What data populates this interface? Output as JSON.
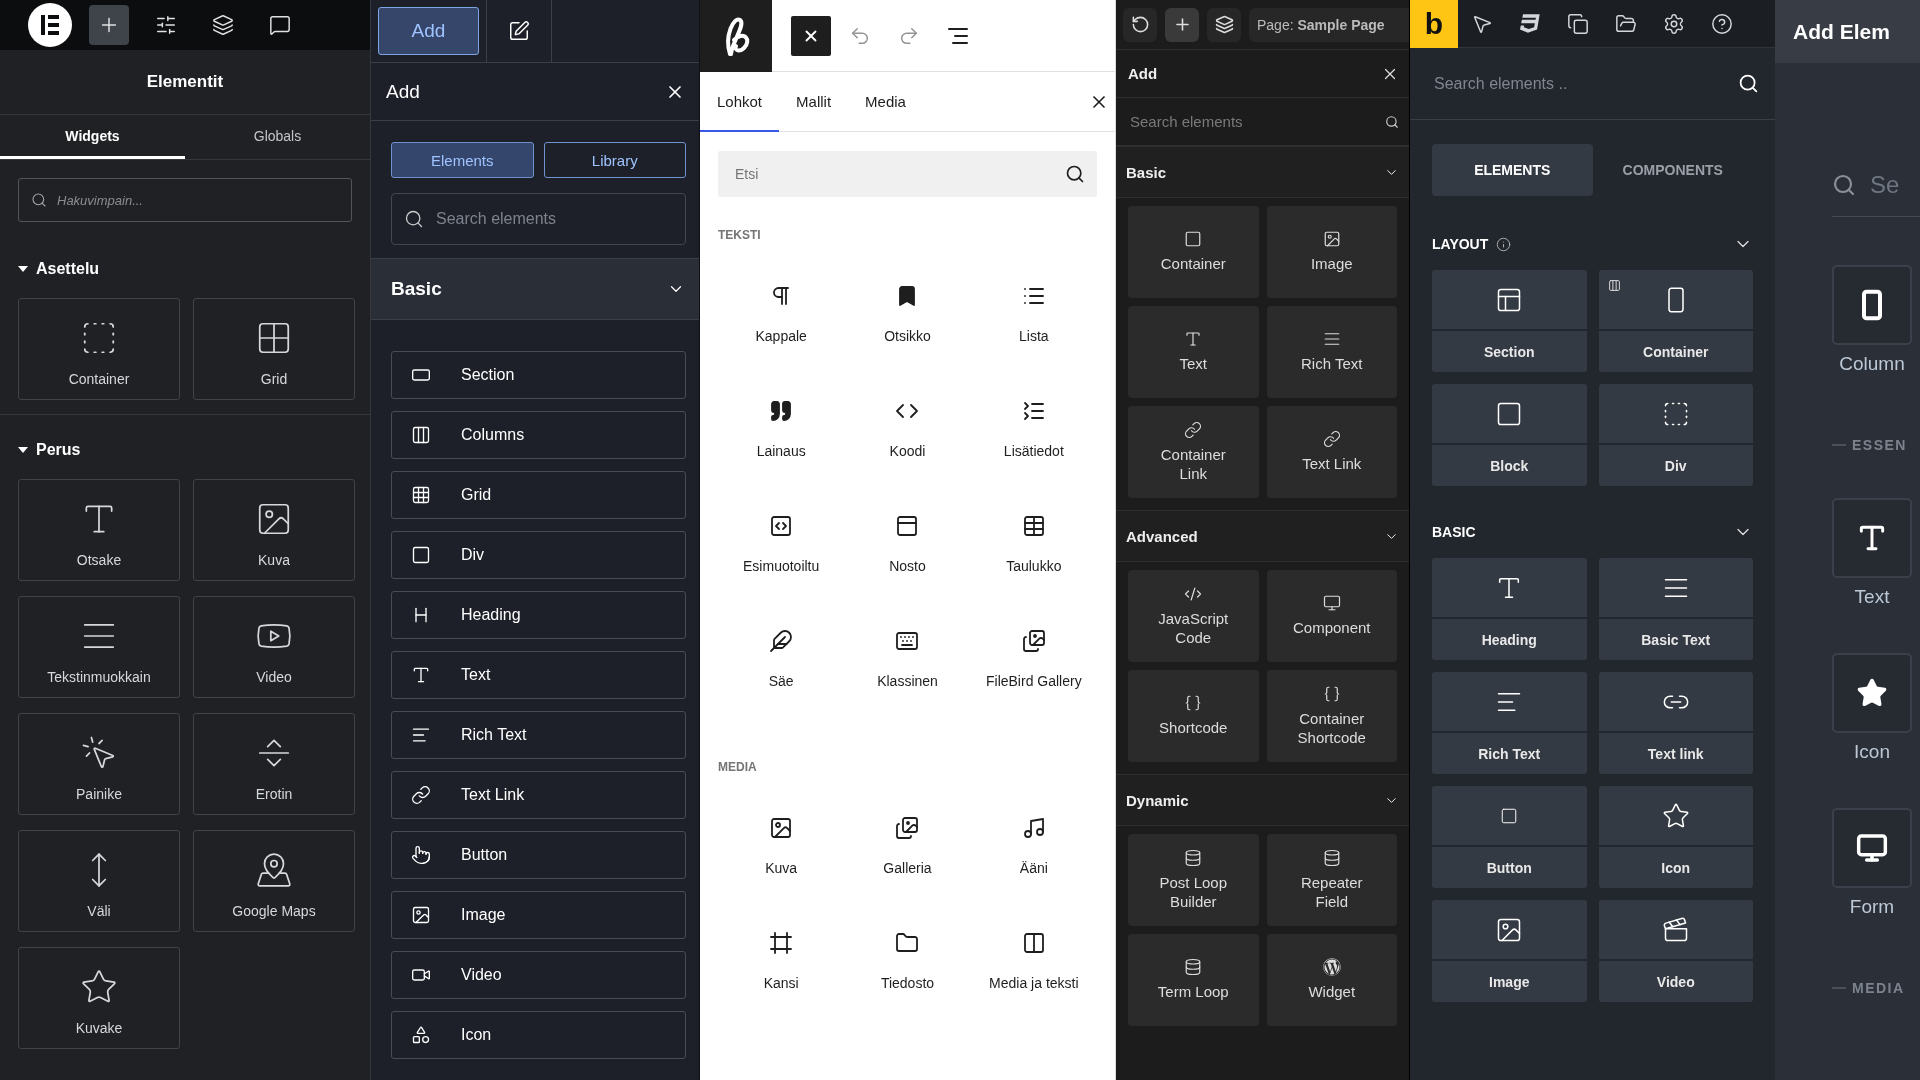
{
  "elementor": {
    "toolbar": [
      {
        "selected": true
      },
      {
        "selected": false
      },
      {
        "selected": false
      },
      {
        "selected": false
      }
    ],
    "title": "Elementit",
    "tabs": [
      {
        "label": "Widgets",
        "selected": true
      },
      {
        "label": "Globals",
        "selected": false
      }
    ],
    "search": {
      "placeholder": "Hakuvimpain..."
    },
    "sections": [
      {
        "title": "Asettelu",
        "expanded": true,
        "widgets": [
          "Container",
          "Grid"
        ]
      },
      {
        "title": "Perus",
        "expanded": true,
        "widgets": [
          "Otsake",
          "Kuva",
          "Tekstinmuokkain",
          "Video",
          "Painike",
          "Erotin",
          "Väli",
          "Google Maps",
          "Kuvake"
        ]
      }
    ]
  },
  "add_panel": {
    "top_button": {
      "label": "Add",
      "selected": true
    },
    "title": "Add",
    "tabs": [
      {
        "label": "Elements",
        "selected": true
      },
      {
        "label": "Library",
        "selected": false
      }
    ],
    "search": {
      "placeholder": "Search elements"
    },
    "section": {
      "title": "Basic",
      "expanded": true
    },
    "items": [
      "Section",
      "Columns",
      "Grid",
      "Div",
      "Heading",
      "Text",
      "Rich Text",
      "Text Link",
      "Button",
      "Image",
      "Video",
      "Icon"
    ]
  },
  "block_inserter": {
    "tabs": [
      {
        "label": "Lohkot",
        "selected": true
      },
      {
        "label": "Mallit",
        "selected": false
      },
      {
        "label": "Media",
        "selected": false
      }
    ],
    "search": {
      "placeholder": "Etsi"
    },
    "categories": [
      {
        "title": "TEKSTI",
        "blocks": [
          "Kappale",
          "Otsikko",
          "Lista",
          "Lainaus",
          "Koodi",
          "Lisätiedot",
          "Esimuotoiltu",
          "Nosto",
          "Taulukko",
          "Säe",
          "Klassinen",
          "FileBird Gallery"
        ]
      },
      {
        "title": "MEDIA",
        "blocks": [
          "Kuva",
          "Galleria",
          "Ääni",
          "Kansi",
          "Tiedosto",
          "Media ja teksti"
        ]
      }
    ]
  },
  "bricks": {
    "toolbar": [
      {
        "selected": false
      },
      {
        "selected": true
      },
      {
        "selected": false
      }
    ],
    "page": "Page: **Sample Page**",
    "title": "Add",
    "search": {
      "placeholder": "Search elements"
    },
    "groups": [
      {
        "title": "Basic",
        "expanded": true,
        "elements": [
          "Container",
          "Image",
          "Text",
          "Rich Text",
          "Container Link",
          "Text Link"
        ]
      },
      {
        "title": "Advanced",
        "expanded": true,
        "elements": [
          "JavaScript Code",
          "Component",
          "Shortcode",
          "Container Shortcode"
        ]
      },
      {
        "title": "Dynamic",
        "expanded": true,
        "elements": [
          "Post Loop Builder",
          "Repeater Field",
          "Term Loop",
          "Widget"
        ]
      }
    ]
  },
  "breakdance": {
    "logo": "b",
    "search": {
      "placeholder": "Search elements .."
    },
    "tabs": [
      {
        "label": "ELEMENTS",
        "selected": true
      },
      {
        "label": "COMPONENTS",
        "selected": false
      }
    ],
    "sections": [
      {
        "title": "LAYOUT",
        "expanded": true,
        "elements": [
          "Section",
          "Container",
          "Block",
          "Div"
        ]
      },
      {
        "title": "BASIC",
        "expanded": true,
        "elements": [
          "Heading",
          "Basic Text",
          "Rich Text",
          "Text link",
          "Button",
          "Icon",
          "Image",
          "Video"
        ]
      }
    ]
  },
  "oxygen": {
    "title": "Add Elem",
    "search": {
      "placeholder": "Se"
    },
    "items": [
      {
        "kind": "element",
        "label": "Column"
      },
      {
        "kind": "heading",
        "label": "ESSEN"
      },
      {
        "kind": "element",
        "label": "Text"
      },
      {
        "kind": "element",
        "label": "Icon"
      },
      {
        "kind": "element",
        "label": "Form"
      },
      {
        "kind": "heading",
        "label": "MEDIA"
      }
    ]
  }
}
